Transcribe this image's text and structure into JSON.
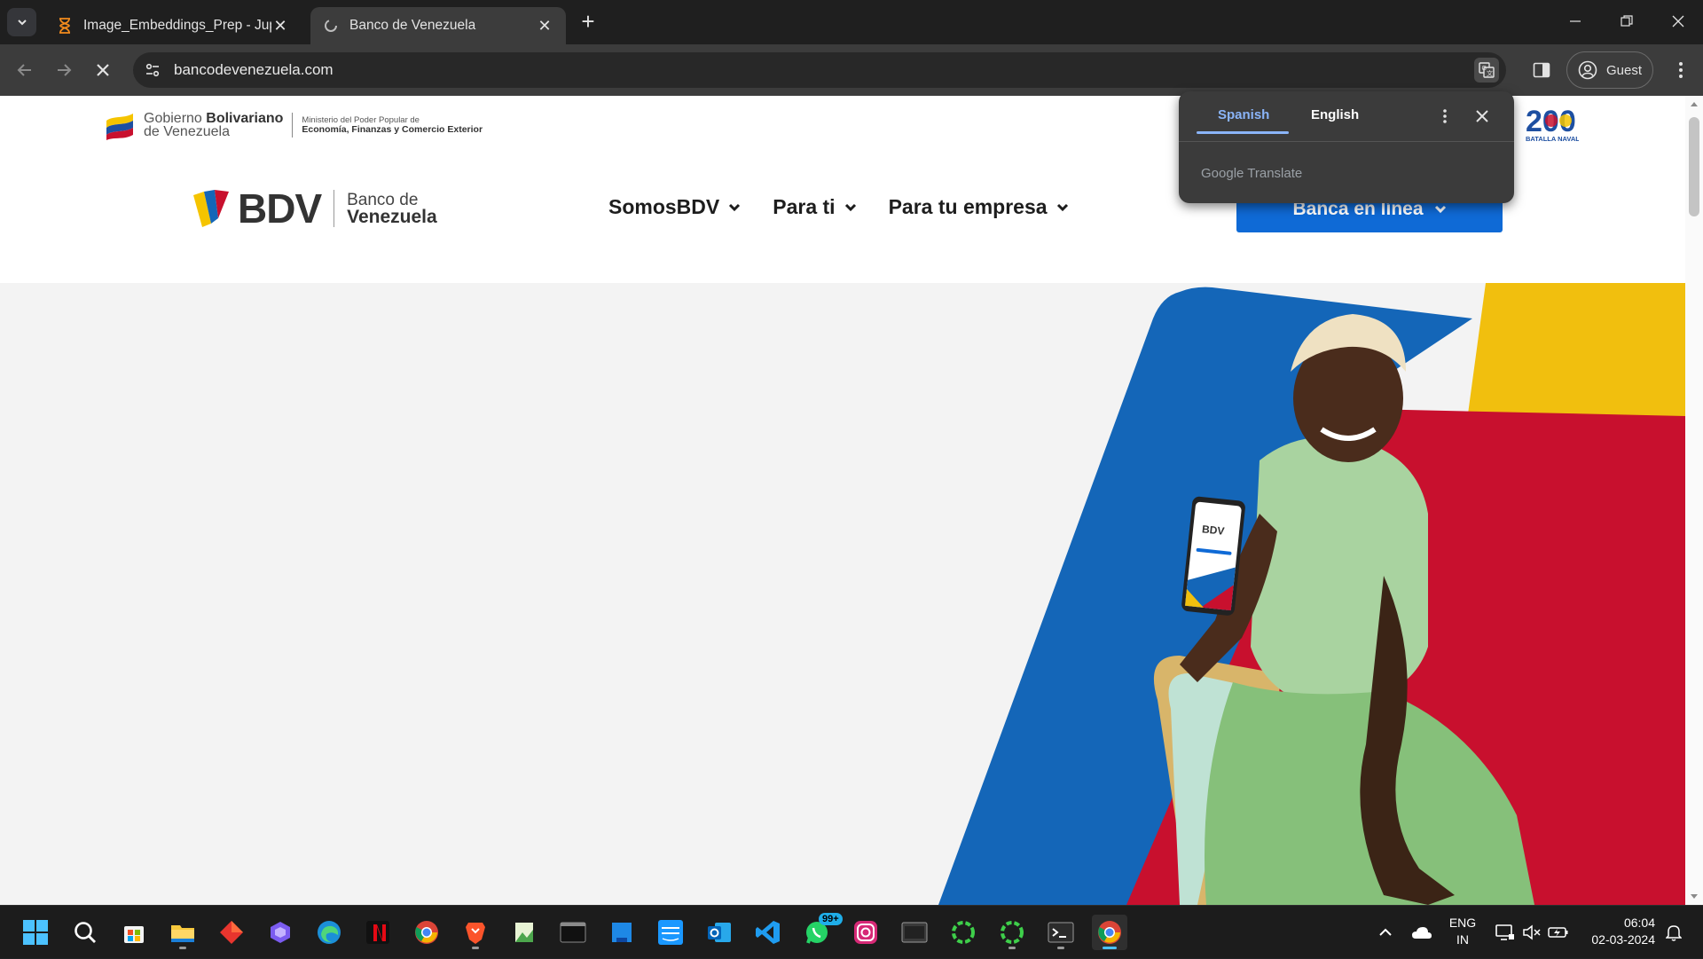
{
  "browser": {
    "tabs": [
      {
        "title": "Image_Embeddings_Prep - Jupy",
        "active": false,
        "icon": "hourglass-icon"
      },
      {
        "title": "Banco de Venezuela",
        "active": true,
        "icon": "loading-icon"
      }
    ],
    "url": "bancodevenezuela.com",
    "profile_label": "Guest"
  },
  "page": {
    "gov": {
      "line1_a": "Gobierno ",
      "line1_b": "Bolivariano",
      "line2": "de Venezuela",
      "ministry_line1": "Ministerio del Poder Popular de",
      "ministry_line2": "Economía, Finanzas y Comercio Exterior"
    },
    "badge_200": {
      "number": "200",
      "caption": "BATALLA NAVAL"
    },
    "logo": {
      "brand": "BDV",
      "bank_line1": "Banco de",
      "bank_line2": "Venezuela"
    },
    "nav": [
      "SomosBDV",
      "Para ti",
      "Para tu empresa"
    ],
    "cta_label": "Banca en línea",
    "hero": {
      "phone_brand": "BDV"
    }
  },
  "translate_popup": {
    "tabs": [
      "Spanish",
      "English"
    ],
    "selected": "Spanish",
    "brand_google": "Google",
    "brand_translate": " Translate"
  },
  "taskbar": {
    "apps": [
      "start",
      "search",
      "store",
      "file-explorer",
      "app-red",
      "copilot",
      "edge",
      "netflix",
      "chrome",
      "brave",
      "app-green",
      "terminal-dark",
      "app-blue",
      "prime-video",
      "outlook",
      "vscode",
      "whatsapp",
      "instagram",
      "app-window",
      "app-ring-1",
      "app-ring-2",
      "terminal",
      "chrome-active"
    ],
    "whatsapp_badge": "99+",
    "language": {
      "line1": "ENG",
      "line2": "IN"
    },
    "time": "06:04",
    "date": "02-03-2024"
  },
  "colors": {
    "accent_blue": "#0f6ad6",
    "brand_yellow": "#f1c40f",
    "brand_red": "#c8102e",
    "brand_blue": "#1466b8"
  }
}
